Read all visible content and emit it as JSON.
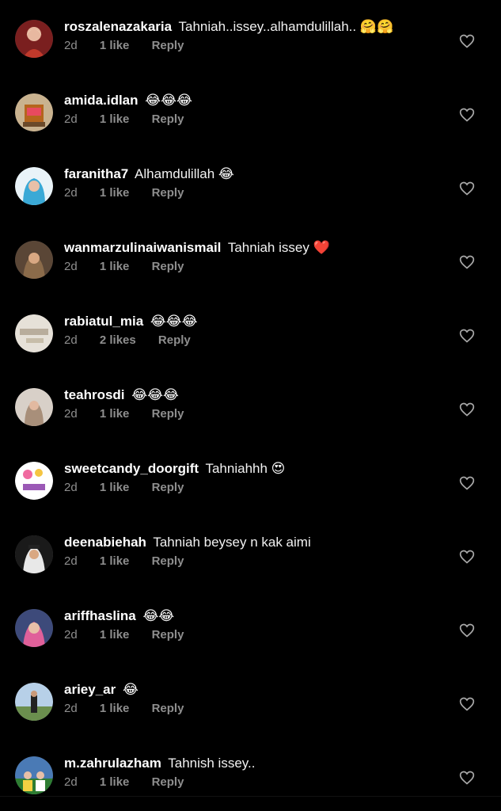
{
  "comments": [
    {
      "username": "roszalenazakaria",
      "text": "Tahniah..issey..alhamdulillah..",
      "emoji": "🤗🤗",
      "age": "2d",
      "likes": "1 like",
      "reply": "Reply",
      "avatar_color": "#c0392b"
    },
    {
      "username": "amida.idlan",
      "text": "",
      "emoji": "😂😂😂",
      "age": "2d",
      "likes": "1 like",
      "reply": "Reply",
      "avatar_color": "#b5651d"
    },
    {
      "username": "faranitha7",
      "text": "Alhamdulillah",
      "emoji": "😂",
      "age": "2d",
      "likes": "1 like",
      "reply": "Reply",
      "avatar_color": "#3aa9d6"
    },
    {
      "username": "wanmarzulinaiwanismail",
      "text": "Tahniah issey",
      "emoji": "❤️",
      "age": "2d",
      "likes": "1 like",
      "reply": "Reply",
      "avatar_color": "#8b6b4a"
    },
    {
      "username": "rabiatul_mia",
      "text": "",
      "emoji": "😂😂😂",
      "age": "2d",
      "likes": "2 likes",
      "reply": "Reply",
      "avatar_color": "#d9d4cc"
    },
    {
      "username": "teahrosdi",
      "text": "",
      "emoji": "😂😂😂",
      "age": "2d",
      "likes": "1 like",
      "reply": "Reply",
      "avatar_color": "#a88f7a"
    },
    {
      "username": "sweetcandy_doorgift",
      "text": "Tahniahhh",
      "emoji": "😍",
      "age": "2d",
      "likes": "1 like",
      "reply": "Reply",
      "avatar_color": "#ffffff"
    },
    {
      "username": "deenabiehah",
      "text": "Tahniah beysey n kak aimi",
      "emoji": "",
      "age": "2d",
      "likes": "1 like",
      "reply": "Reply",
      "avatar_color": "#1a1a1a"
    },
    {
      "username": "ariffhaslina",
      "text": "",
      "emoji": "😂😂",
      "age": "2d",
      "likes": "1 like",
      "reply": "Reply",
      "avatar_color": "#3d4a7a"
    },
    {
      "username": "ariey_ar",
      "text": "",
      "emoji": "😂",
      "age": "2d",
      "likes": "1 like",
      "reply": "Reply",
      "avatar_color": "#6b8f4e"
    },
    {
      "username": "m.zahrulazham",
      "text": "Tahnish issey..",
      "emoji": "",
      "age": "2d",
      "likes": "1 like",
      "reply": "Reply",
      "avatar_color": "#4a7ab5"
    }
  ],
  "colors": {
    "background": "#000000",
    "meta_text": "#8e8e8e",
    "heart_outline": "#a8a8a8"
  },
  "icons": {
    "like": "heart-outline-icon"
  }
}
